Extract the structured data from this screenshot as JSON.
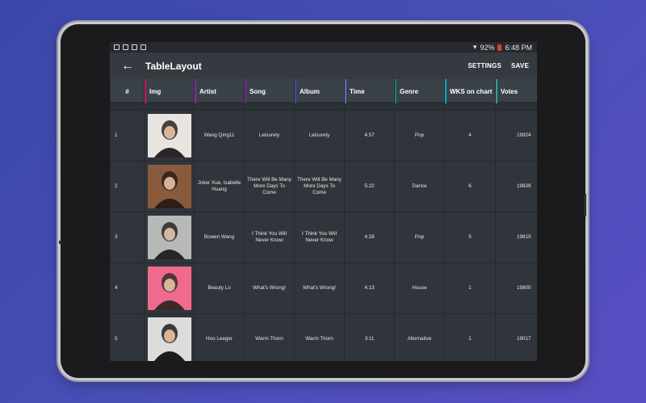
{
  "status_bar": {
    "battery": "92%",
    "time": "6:48 PM"
  },
  "toolbar": {
    "title": "TableLayout",
    "settings_label": "SETTINGS",
    "save_label": "SAVE",
    "back_icon": "←"
  },
  "table": {
    "headers": [
      {
        "label": "#",
        "accent": ""
      },
      {
        "label": "Img",
        "accent": "#c2185b"
      },
      {
        "label": "Artist",
        "accent": "#8e24aa"
      },
      {
        "label": "Song",
        "accent": "#7b1fa2"
      },
      {
        "label": "Album",
        "accent": "#3949ab"
      },
      {
        "label": "Time",
        "accent": "#5c6bc0"
      },
      {
        "label": "Genre",
        "accent": "#00897b"
      },
      {
        "label": "WKS on chart",
        "accent": "#00acc1"
      },
      {
        "label": "Votes",
        "accent": "#26a69a"
      }
    ],
    "rows": [
      {
        "num": "1",
        "artist": "Wang Qing11",
        "song": "Leisurely",
        "album": "Leisurely",
        "time": "4:57",
        "genre": "Pop",
        "wks": "4",
        "votes": "19924",
        "photo": {
          "bg": "#e8e4e0",
          "fg": "#2a2424"
        }
      },
      {
        "num": "2",
        "artist": "Joker Xue, Isabelle Huang",
        "song": "There Will Be Many More Days To Come",
        "album": "There Will Be Many More Days To Come",
        "time": "5:22",
        "genre": "Dance",
        "wks": "6",
        "votes": "19839",
        "photo": {
          "bg": "#8a5a3c",
          "fg": "#2b1d17"
        }
      },
      {
        "num": "3",
        "artist": "Bowen Wang",
        "song": "I Think You Will Never Know",
        "album": "I Think You Will Never Know",
        "time": "4:28",
        "genre": "Pop",
        "wks": "5",
        "votes": "19819",
        "photo": {
          "bg": "#b7b9b8",
          "fg": "#262626"
        }
      },
      {
        "num": "4",
        "artist": "Beauty Lo",
        "song": "What's Wrong!",
        "album": "What's Wrong!",
        "time": "4:13",
        "genre": "House",
        "wks": "1",
        "votes": "19800",
        "photo": {
          "bg": "#f06a8e",
          "fg": "#3a2a2a"
        }
      },
      {
        "num": "5",
        "artist": "Hoo Leeger",
        "song": "Warm Thorn",
        "album": "Warm Thorn",
        "time": "3:11",
        "genre": "Alternative",
        "wks": "1",
        "votes": "19017",
        "photo": {
          "bg": "#dcdcdc",
          "fg": "#1d1d1d"
        }
      }
    ]
  }
}
